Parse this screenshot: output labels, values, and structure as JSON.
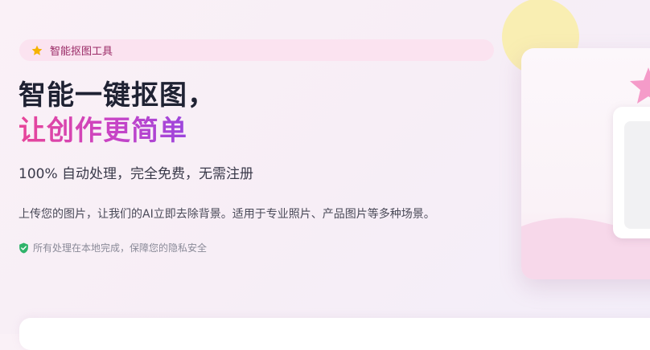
{
  "hero": {
    "badge_label": "智能抠图工具",
    "title_line1": "智能一键抠图，",
    "title_line2": "让创作更简单",
    "subtitle": "100% 自动处理，完全免费，无需注册",
    "description": "上传您的图片，让我们的AI立即去除背景。适用于专业照片、产品图片等多种场景。",
    "privacy_note": "所有处理在本地完成，保障您的隐私安全"
  },
  "icons": {
    "badge_icon": "star-icon",
    "privacy_icon": "shield-check-icon",
    "decoration_icon": "pink-star-icon"
  },
  "colors": {
    "badge_bg": "#fbe3f0",
    "badge_text": "#9a2a66",
    "title_dark": "#1f2233",
    "gradient_start": "#e84598",
    "gradient_end": "#9b45dd",
    "star_yellow": "#f5b300",
    "shield_green": "#2fb36a",
    "decor_pink": "#f59bc9",
    "decor_yellow": "#f9edae"
  }
}
